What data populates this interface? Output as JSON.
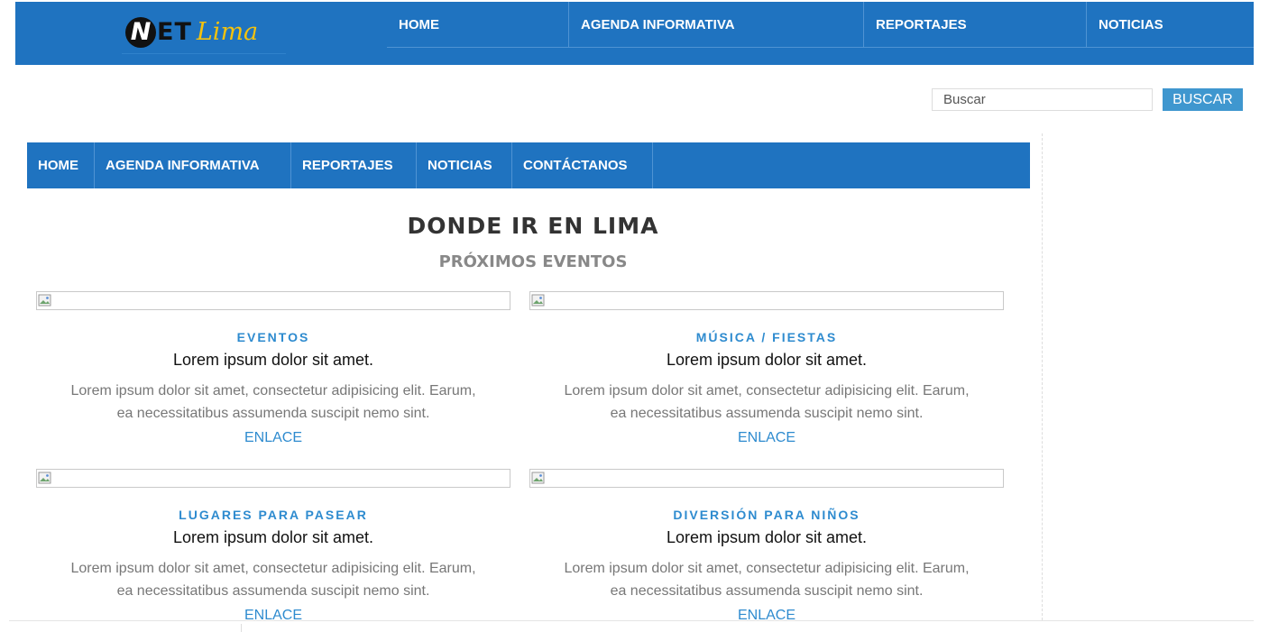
{
  "header": {
    "logo": {
      "n": "N",
      "et": "ET",
      "lima": "Lima"
    },
    "nav": [
      "HOME",
      "AGENDA INFORMATIVA",
      "REPORTAJES",
      "NOTICIAS"
    ]
  },
  "search": {
    "placeholder": "Buscar",
    "button_label": "BUSCAR"
  },
  "main_nav": [
    "HOME",
    "AGENDA INFORMATIVA",
    "REPORTAJES",
    "NOTICIAS",
    "CONTÁCTANOS"
  ],
  "page": {
    "title": "DONDE IR EN LIMA",
    "subtitle": "PRÓXIMOS EVENTOS"
  },
  "cards": [
    {
      "category": "EVENTOS",
      "title": "Lorem ipsum dolor sit amet.",
      "text_line1": "Lorem ipsum dolor sit amet, consectetur adipisicing elit. Earum,",
      "text_line2": "ea necessitatibus assumenda suscipit nemo sint.",
      "link": "ENLACE"
    },
    {
      "category": "MÚSICA / FIESTAS",
      "title": "Lorem ipsum dolor sit amet.",
      "text_line1": "Lorem ipsum dolor sit amet, consectetur adipisicing elit. Earum,",
      "text_line2": "ea necessitatibus assumenda suscipit nemo sint.",
      "link": "ENLACE"
    },
    {
      "category": "LUGARES PARA PASEAR",
      "title": "Lorem ipsum dolor sit amet.",
      "text_line1": "Lorem ipsum dolor sit amet, consectetur adipisicing elit. Earum,",
      "text_line2": "ea necessitatibus assumenda suscipit nemo sint.",
      "link": "ENLACE"
    },
    {
      "category": "DIVERSIÓN PARA NIÑOS",
      "title": "Lorem ipsum dolor sit amet.",
      "text_line1": "Lorem ipsum dolor sit amet, consectetur adipisicing elit. Earum,",
      "text_line2": "ea necessitatibus assumenda suscipit nemo sint.",
      "link": "ENLACE"
    }
  ],
  "colors": {
    "brand_blue": "#1f73c0",
    "accent_blue": "#2e8bcf",
    "logo_yellow": "#f4c20d"
  },
  "icons": {
    "image_placeholder": "broken-image-icon"
  }
}
